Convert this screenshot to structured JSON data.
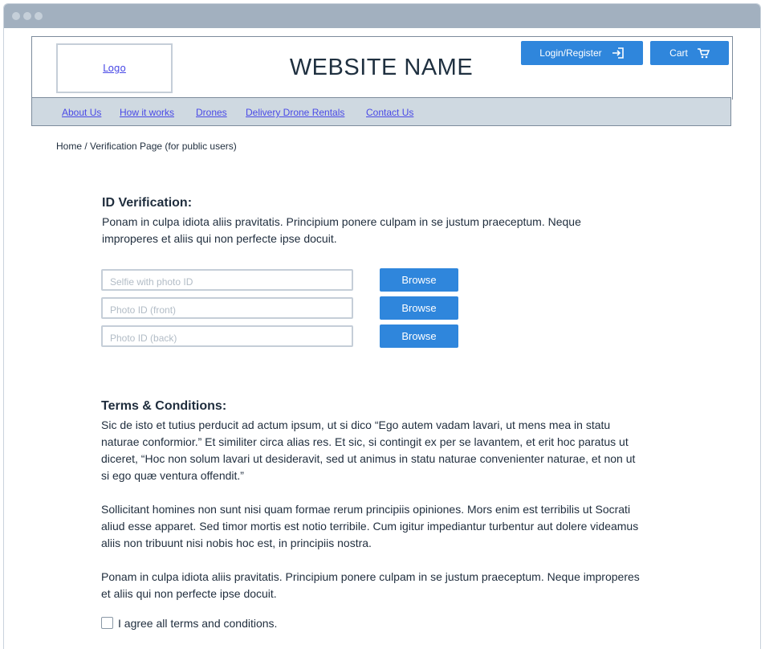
{
  "header": {
    "logo_label": "Logo",
    "site_name": "WEBSITE NAME",
    "login_label": "Login/Register",
    "cart_label": "Cart"
  },
  "nav": {
    "items": [
      "About Us",
      "How it works",
      "Drones",
      "Delivery Drone Rentals",
      "Contact Us"
    ]
  },
  "breadcrumb": "Home / Verification Page (for public users)",
  "id_verification": {
    "title": "ID Verification:",
    "text": "Ponam in culpa idiota aliis pravitatis. Principium ponere culpam in se justum praeceptum. Neque improperes et aliis qui non perfecte ipse docuit.",
    "fields": [
      {
        "placeholder": "Selfie with photo ID",
        "button": "Browse"
      },
      {
        "placeholder": "Photo ID (front)",
        "button": "Browse"
      },
      {
        "placeholder": "Photo ID (back)",
        "button": "Browse"
      }
    ]
  },
  "terms": {
    "title": "Terms & Conditions:",
    "paragraphs": [
      "Sic de isto et tutius perducit ad actum ipsum, ut si dico “Ego autem vadam lavari, ut mens mea in statu naturae conformior.” Et similiter circa alias res. Et sic, si contingit ex per se lavantem, et erit hoc paratus ut diceret, “Hoc non solum lavari ut desideravit, sed ut animus in statu naturae convenienter naturae, et non ut si ego quæ ventura offendit.”",
      "Sollicitant homines non sunt nisi quam formae rerum principiis opiniones. Mors enim est terribilis ut Socrati aliud esse apparet. Sed timor mortis est notio terribile. Cum igitur impediantur turbentur aut dolere videamus aliis non tribuunt nisi nobis hoc est, in principiis nostra.",
      "Ponam in culpa idiota aliis pravitatis. Principium ponere culpam in se justum praeceptum. Neque improperes et aliis qui non perfecte ipse docuit."
    ],
    "agree_label": "I agree all terms and conditions.",
    "agree_checked": false
  },
  "colors": {
    "accent": "#2f86dc",
    "titlebar": "#a2b0bf",
    "navbar": "#cfd9e1",
    "link": "#4a4ae6"
  }
}
